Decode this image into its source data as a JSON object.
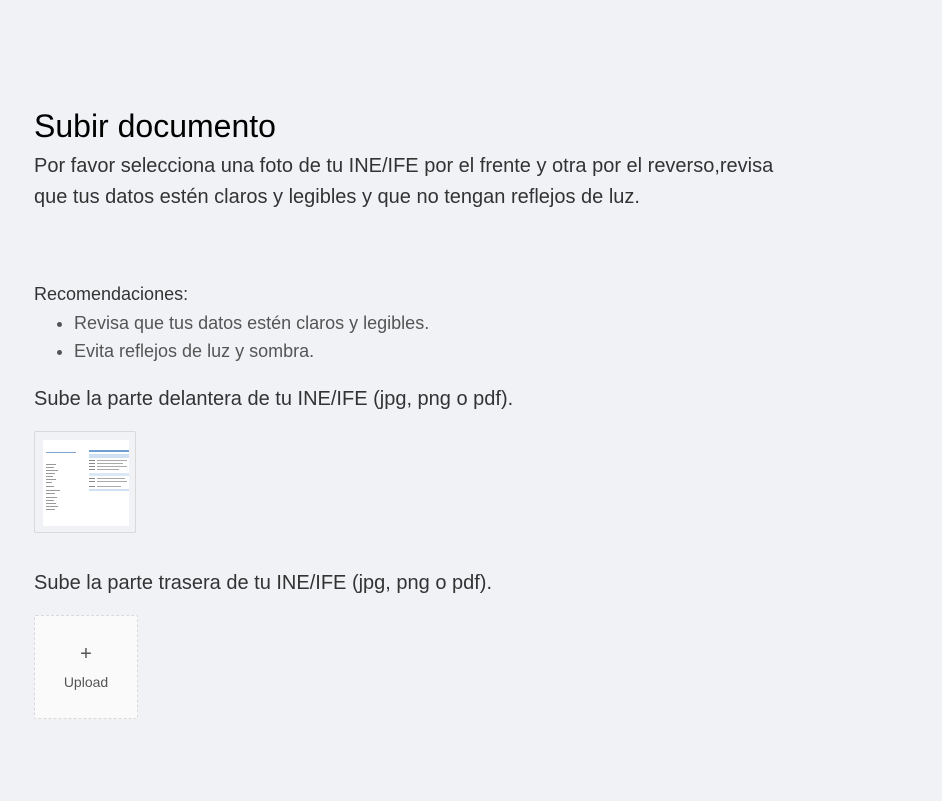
{
  "header": {
    "title": "Subir documento",
    "intro": "Por favor selecciona una foto de tu INE/IFE por el frente y otra por el reverso,revisa que tus datos estén claros y legibles y que no tengan reflejos de luz."
  },
  "recommendations": {
    "title": "Recomendaciones:",
    "items": [
      "Revisa que tus datos estén claros y legibles.",
      "Evita reflejos de luz y sombra."
    ]
  },
  "front_upload": {
    "label": "Sube la parte delantera de tu INE/IFE (jpg, png o pdf).",
    "thumbnail_icon": "document-thumbnail"
  },
  "back_upload": {
    "label": "Sube la parte trasera de tu INE/IFE (jpg, png o pdf).",
    "icon": "plus-icon",
    "button_text": "Upload"
  }
}
